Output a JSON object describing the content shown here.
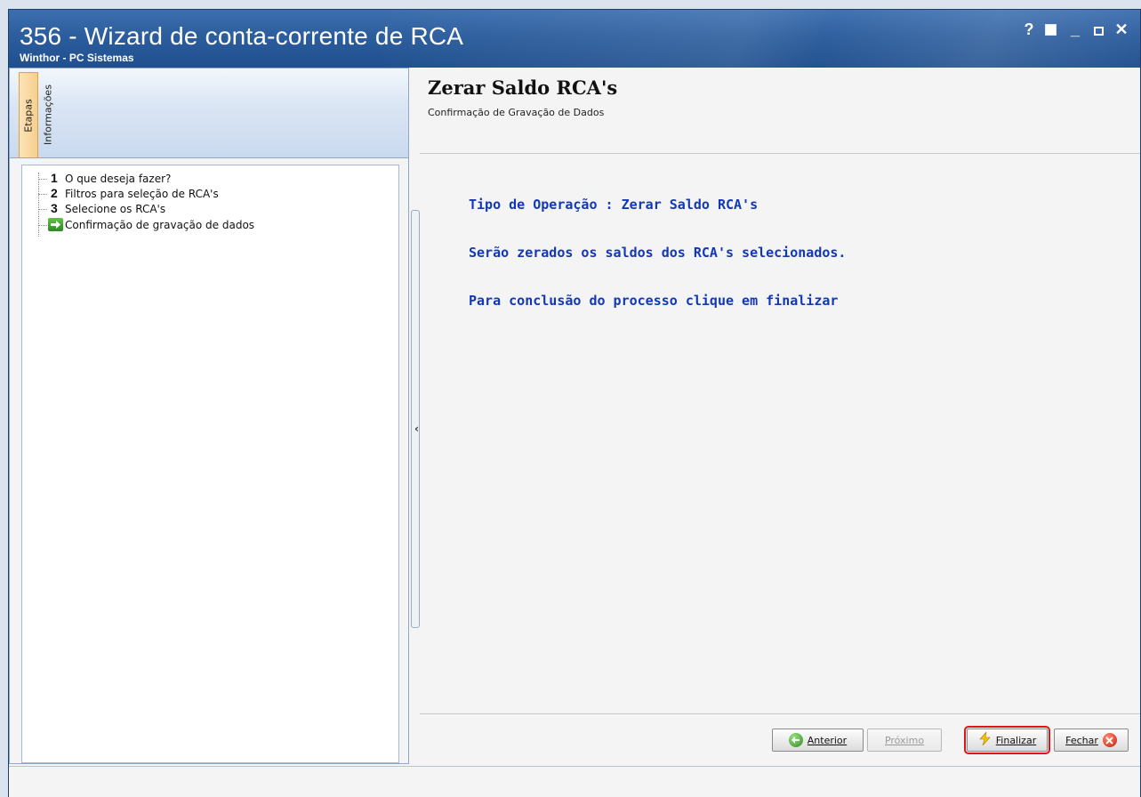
{
  "window": {
    "title": "356 - Wizard de conta-corrente de RCA",
    "subtitle": "Winthor - PC Sistemas",
    "controls": {
      "help": "?",
      "minimize": "_",
      "close": "✕"
    }
  },
  "left_panel": {
    "tabs": [
      {
        "label": "Etapas",
        "active": true
      },
      {
        "label": "Informações",
        "active": false
      }
    ],
    "steps": [
      {
        "number": "1",
        "label": "O que deseja fazer?"
      },
      {
        "number": "2",
        "label": "Filtros para seleção de RCA's"
      },
      {
        "number": "3",
        "label": "Selecione os RCA's"
      },
      {
        "icon": "green-arrow-icon",
        "label": "Confirmação de gravação de dados",
        "current": true
      }
    ]
  },
  "main": {
    "title": "Zerar Saldo RCA's",
    "subtitle": "Confirmação de Gravação de Dados",
    "messages": [
      "Tipo de Operação : Zerar Saldo RCA's",
      "Serão zerados os saldos dos RCA's selecionados.",
      "Para conclusão do processo clique em finalizar"
    ]
  },
  "buttons": {
    "anterior": {
      "label": "Anterior",
      "icon": "back-arrow-icon"
    },
    "proximo": {
      "label": "Próximo",
      "enabled": false
    },
    "finalizar": {
      "label": "Finalizar",
      "icon": "lightning-icon",
      "highlight": "#e01414"
    },
    "fechar": {
      "label": "Fechar",
      "icon": "close-circle-icon"
    }
  },
  "colors": {
    "titlebar": "#2c5d9d",
    "message_text": "#1238b8",
    "highlight": "#e01414"
  }
}
